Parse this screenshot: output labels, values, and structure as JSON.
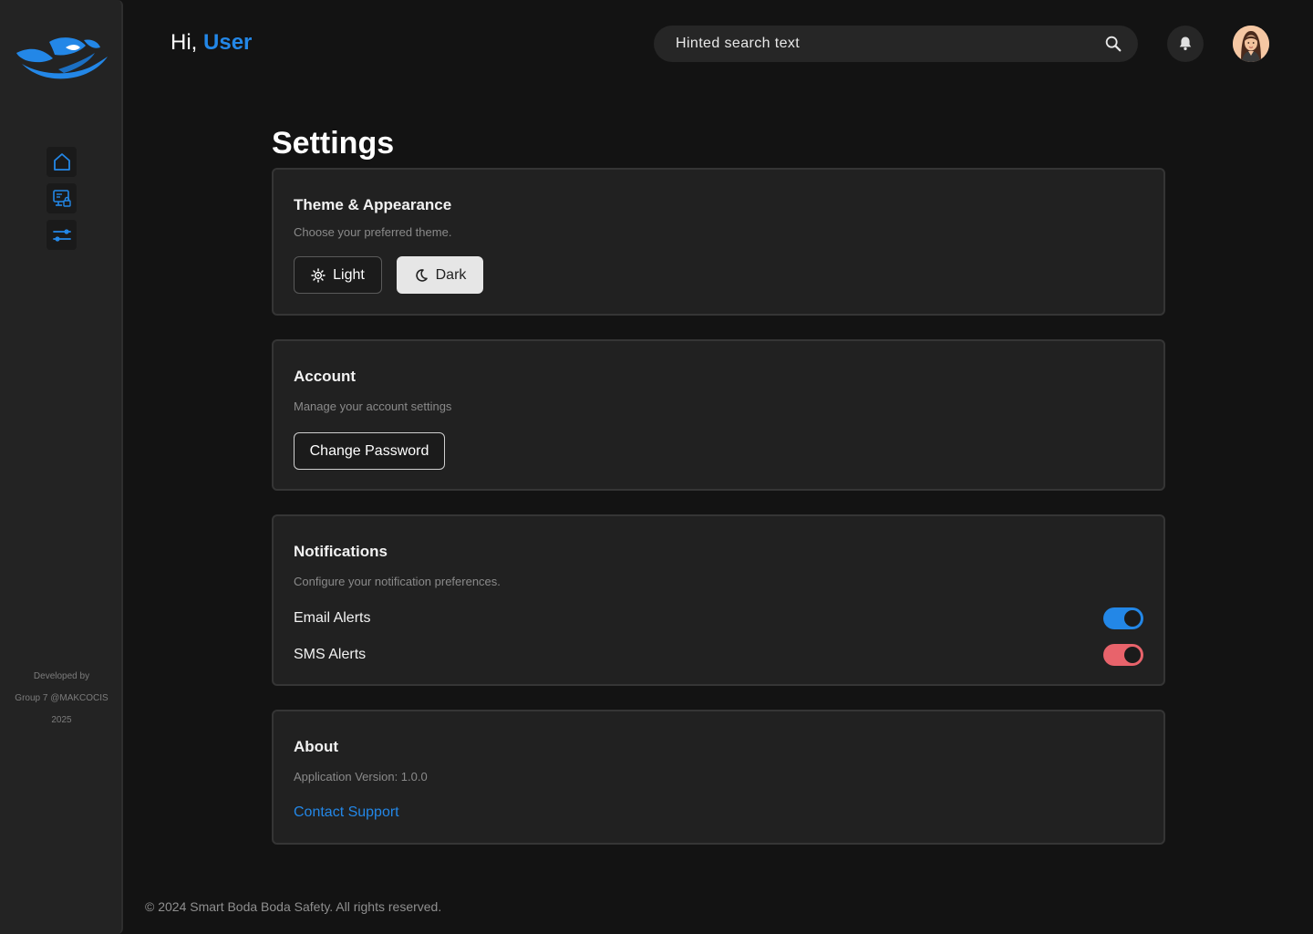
{
  "sidebar": {
    "nav": [
      {
        "icon": "home-icon"
      },
      {
        "icon": "monitor-lock-icon"
      },
      {
        "icon": "sliders-icon"
      }
    ],
    "credit": {
      "line1": "Developed by",
      "line2": "Group 7 @MAKCOCIS",
      "line3": "2025"
    }
  },
  "header": {
    "greeting_prefix": "Hi,",
    "user_name": "User",
    "search_placeholder": "Hinted search text"
  },
  "page": {
    "title": "Settings"
  },
  "theme": {
    "title": "Theme & Appearance",
    "description": "Choose your preferred theme.",
    "light_label": "Light",
    "dark_label": "Dark",
    "selected": "Dark"
  },
  "account": {
    "title": "Account",
    "description": "Manage your account settings",
    "change_password_label": "Change Password"
  },
  "notifications": {
    "title": "Notifications",
    "description": "Configure your notification preferences.",
    "email_label": "Email Alerts",
    "email_enabled": true,
    "sms_label": "SMS Alerts",
    "sms_enabled": true
  },
  "about": {
    "title": "About",
    "version": "Application Version: 1.0.0",
    "support_label": "Contact Support"
  },
  "footer": {
    "text": "© 2024 Smart Boda Boda Safety. All rights reserved."
  },
  "colors": {
    "accent": "#2387e7",
    "email_toggle": "#2387e7",
    "sms_toggle": "#e8636b",
    "background": "#131313",
    "card": "#212121"
  }
}
